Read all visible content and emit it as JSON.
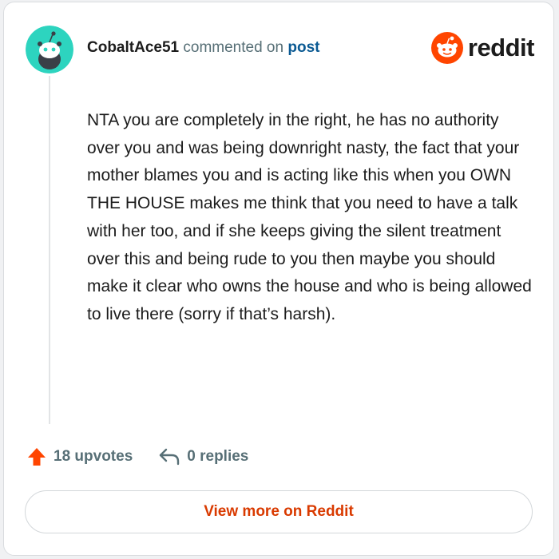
{
  "comment": {
    "author": "CobaltAce51",
    "action_text": "commented on",
    "post_link": "post",
    "body": "NTA you are completely in the right, he has no authority over you and was being downright nasty, the fact that your mother blames you and is acting like this when you OWN THE HOUSE makes me think that you need to have a talk with her too, and if she keeps giving the silent treatment over this and being rude to you then maybe you should make it clear who owns the house and who is being allowed to live there (sorry if that’s harsh)."
  },
  "brand": {
    "name": "reddit",
    "logo_icon": "reddit-snoo-icon",
    "color": "#ff4500"
  },
  "avatar": {
    "icon": "snoo-avatar-icon",
    "color": "#2dd4bf"
  },
  "actions": {
    "upvotes": "18 upvotes",
    "upvote_icon": "upvote-arrow-icon",
    "upvote_color": "#ff4500",
    "replies": "0 replies",
    "reply_icon": "reply-arrow-icon"
  },
  "footer": {
    "view_more_label": "View more on Reddit",
    "accent": "#d93a00"
  }
}
